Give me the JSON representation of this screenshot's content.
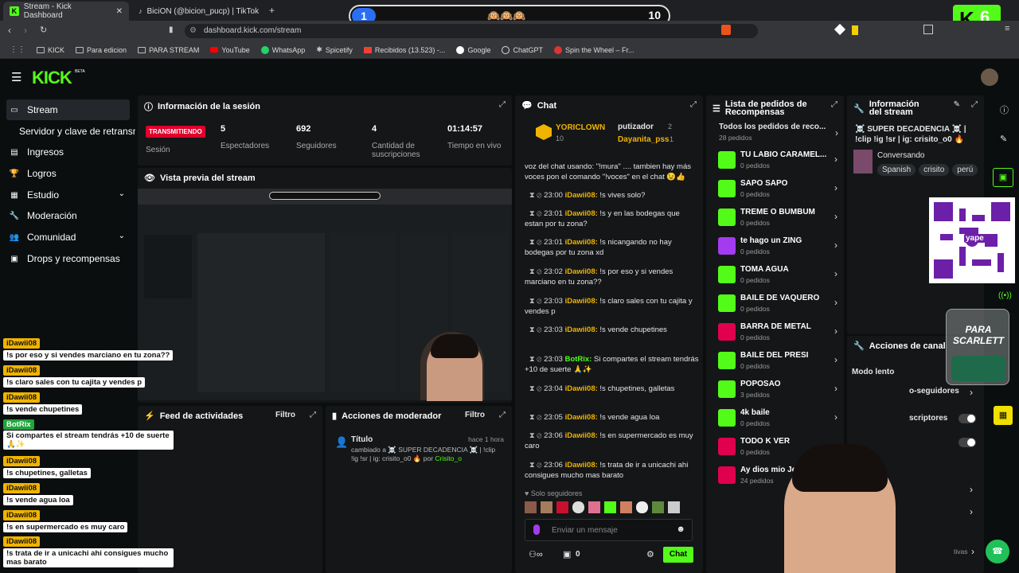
{
  "browser": {
    "tabs": [
      {
        "title": "Stream - Kick Dashboard"
      },
      {
        "title": "BiciON (@bicion_pucp) | TikTok"
      }
    ],
    "url": "dashboard.kick.com/stream",
    "bookmarks": [
      "KICK",
      "Para edicion",
      "PARA STREAM",
      "YouTube",
      "WhatsApp",
      "Spicetify",
      "Recibidos (13.523) -...",
      "Google",
      "ChatGPT",
      "Spin the Wheel – Fr..."
    ]
  },
  "overlay": {
    "score_left": "1",
    "score_right": "10",
    "emojis": "🙉🙉🙉",
    "badge_number": "6",
    "jar_text": "PARA SCARLETT"
  },
  "header": {
    "logo": "KICK",
    "beta": "BETA"
  },
  "sidebar": {
    "items": [
      {
        "label": "Stream"
      },
      {
        "label": "Servidor y clave de retransmisión"
      },
      {
        "label": "Ingresos"
      },
      {
        "label": "Logros"
      },
      {
        "label": "Estudio"
      },
      {
        "label": "Moderación"
      },
      {
        "label": "Comunidad"
      },
      {
        "label": "Drops y recompensas"
      }
    ]
  },
  "session": {
    "title": "Información de la sesión",
    "status": "TRANSMITIENDO",
    "status_label": "Sesión",
    "stats": [
      {
        "value": "5",
        "label": "Espectadores"
      },
      {
        "value": "692",
        "label": "Seguidores"
      },
      {
        "value": "4",
        "label": "Cantidad de suscripciones"
      },
      {
        "value": "01:14:57",
        "label": "Tiempo en vivo"
      }
    ]
  },
  "preview": {
    "title": "Vista previa del stream"
  },
  "feed": {
    "title": "Feed de actividades",
    "filter": "Filtro"
  },
  "modactions": {
    "title": "Acciones de moderador",
    "filter": "Filtro",
    "item_title": "Título",
    "item_time": "hace 1 hora",
    "item_text": "cambiado a ☠️ SUPER DECADENCIA ☠️ | !clip !ig !sr | ig: crisito_o0 🔥 por",
    "item_user": "Crisito_o"
  },
  "chat": {
    "title": "Chat",
    "top_user": "YORICLOWN",
    "top_count": "10",
    "top2_user": "putizador",
    "top2_count": "2",
    "top3_user": "Dayanita_pss",
    "top3_count": "1",
    "intro": "voz del chat usando: \"!mura\" .... tambien hay más voces pon el comando \"!voces\" en el chat 😉👍",
    "messages": [
      {
        "time": "23:00",
        "user": "iDawii08:",
        "text": "!s vives solo?"
      },
      {
        "time": "23:01",
        "user": "iDawii08:",
        "text": "!s y en las bodegas que estan por tu zona?"
      },
      {
        "time": "23:01",
        "user": "iDawii08:",
        "text": "!s nicangando no hay bodegas por tu zona xd"
      },
      {
        "time": "23:02",
        "user": "iDawii08:",
        "text": "!s por eso y si vendes marciano en tu zona??"
      },
      {
        "time": "23:03",
        "user": "iDawii08:",
        "text": "!s claro sales con tu cajita y vendes p"
      },
      {
        "time": "23:03",
        "user": "iDawii08:",
        "text": "!s vende chupetines"
      },
      {
        "time": "23:03",
        "user": "BotRix:",
        "text": "Si compartes el stream tendrás +10 de suerte 🙏✨"
      },
      {
        "time": "23:04",
        "user": "iDawii08:",
        "text": "!s chupetines, galletas"
      },
      {
        "time": "23:05",
        "user": "iDawii08:",
        "text": "!s vende agua loa"
      },
      {
        "time": "23:06",
        "user": "iDawii08:",
        "text": "!s en supermercado es muy caro"
      },
      {
        "time": "23:06",
        "user": "iDawii08:",
        "text": "!s trata de ir a unicachi ahi consigues mucho mas barato"
      }
    ],
    "followers_only": "Solo seguidores",
    "placeholder": "Enviar un mensaje",
    "count": "0",
    "send": "Chat"
  },
  "rewards": {
    "title": "Lista de pedidos de Recompensas",
    "all": "Todos los pedidos de reco...",
    "all_count": "28 pedidos",
    "items": [
      {
        "name": "TU LABIO CARAMEL...",
        "count": "0 pedidos",
        "color": "#53fc18"
      },
      {
        "name": "SAPO SAPO",
        "count": "0 pedidos",
        "color": "#53fc18"
      },
      {
        "name": "TREME O BUMBUM",
        "count": "0 pedidos",
        "color": "#53fc18"
      },
      {
        "name": "te hago un ZING",
        "count": "0 pedidos",
        "color": "#a33cf0"
      },
      {
        "name": "TOMA AGUA",
        "count": "0 pedidos",
        "color": "#53fc18"
      },
      {
        "name": "BAILE DE VAQUERO",
        "count": "0 pedidos",
        "color": "#53fc18"
      },
      {
        "name": "BARRA DE METAL",
        "count": "0 pedidos",
        "color": "#e0004e"
      },
      {
        "name": "BAILE DEL PRESI",
        "count": "0 pedidos",
        "color": "#53fc18"
      },
      {
        "name": "POPOSAO",
        "count": "3 pedidos",
        "color": "#53fc18"
      },
      {
        "name": "4k baile",
        "count": "0 pedidos",
        "color": "#53fc18"
      },
      {
        "name": "TODO K VER",
        "count": "0 pedidos",
        "color": "#e0004e"
      },
      {
        "name": "Ay dios mio Je",
        "count": "24 pedidos",
        "color": "#e0004e"
      }
    ]
  },
  "channel": {
    "title": "Información del stream",
    "stream_title": "☠️ SUPER DECADENCIA ☠️ | !clip !ig !sr | ig: crisito_o0 🔥",
    "category": "Conversando",
    "tags": [
      "Spanish",
      "crisito",
      "perú"
    ],
    "actions_title": "Acciones de canal",
    "slow_mode": "Modo lento",
    "followers_row": "o-seguidores",
    "subs_row": "scriptores",
    "qr_label": "yape",
    "bottom_label": "tivas"
  },
  "overlay_chat": [
    {
      "user": "iDawii08",
      "text": "!s por eso y si vendes marciano en tu zona??"
    },
    {
      "user": "iDawii08",
      "text": "!s claro sales con tu cajita y vendes p"
    },
    {
      "user": "iDawii08",
      "text": "!s vende chupetines"
    },
    {
      "user": "BotRix",
      "text": "Si compartes el stream tendrás +10 de suerte 🙏✨"
    },
    {
      "user": "iDawii08",
      "text": "!s chupetines, galletas"
    },
    {
      "user": "iDawii08",
      "text": "!s vende agua loa"
    },
    {
      "user": "iDawii08",
      "text": "!s en supermercado es muy caro"
    },
    {
      "user": "iDawii08",
      "text": "!s trata de ir a unicachi ahi consigues mucho mas barato"
    }
  ]
}
